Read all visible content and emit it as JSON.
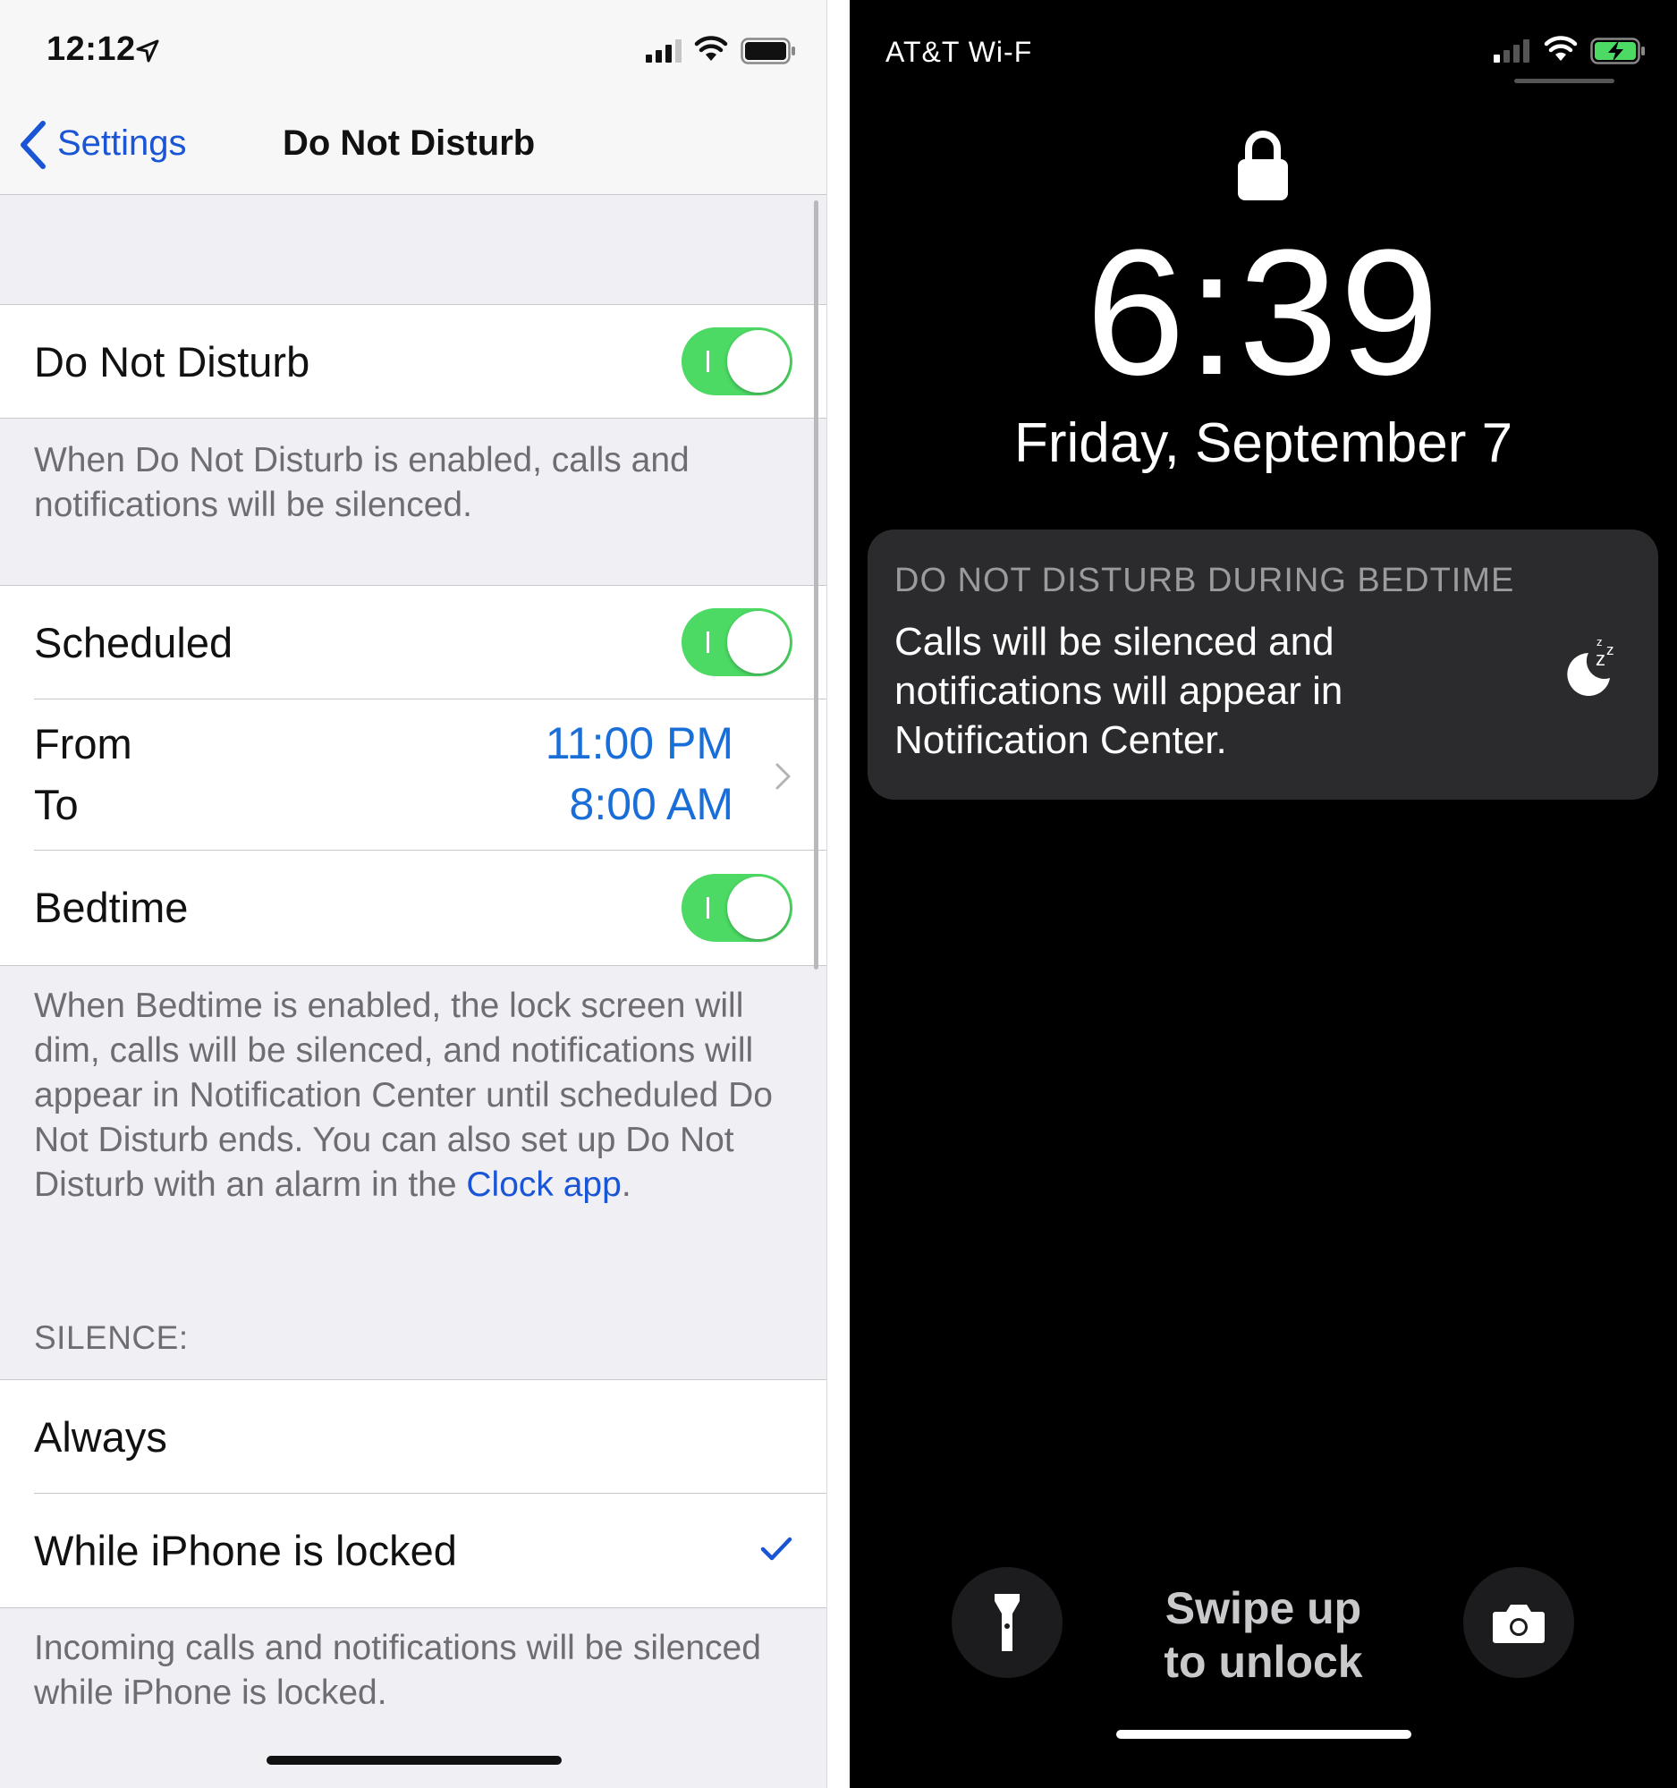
{
  "settings_screen": {
    "status_time": "12:12",
    "nav": {
      "back_label": "Settings",
      "title": "Do Not Disturb"
    },
    "dnd": {
      "label": "Do Not Disturb",
      "enabled": true,
      "footer": "When Do Not Disturb is enabled, calls and notifications will be silenced."
    },
    "scheduled": {
      "label": "Scheduled",
      "enabled": true
    },
    "schedule": {
      "from_label": "From",
      "from_value": "11:00 PM",
      "to_label": "To",
      "to_value": "8:00 AM"
    },
    "bedtime": {
      "label": "Bedtime",
      "enabled": true,
      "footer_prefix": "When Bedtime is enabled, the lock screen will dim, calls will be silenced, and notifications will appear in Notification Center until scheduled Do Not Disturb ends. You can also set up Do Not Disturb with an alarm in the ",
      "footer_link": "Clock app",
      "footer_suffix": "."
    },
    "silence": {
      "header": "SILENCE:",
      "options": [
        {
          "label": "Always",
          "selected": false
        },
        {
          "label": "While iPhone is locked",
          "selected": true
        }
      ],
      "footer": "Incoming calls and notifications will be silenced while iPhone is locked."
    },
    "colors": {
      "accent": "#1a55d6",
      "toggle_on": "#4cd964"
    }
  },
  "lock_screen": {
    "carrier": "AT&T Wi-F",
    "time": "6:39",
    "date": "Friday, September 7",
    "notification": {
      "title": "DO NOT DISTURB DURING BEDTIME",
      "body": "Calls will be silenced and notifications will appear in Notification Center.",
      "icon": "moon-sleep-icon"
    },
    "swipe_line1": "Swipe up",
    "swipe_line2": "to unlock",
    "icons": {
      "left": "flashlight-icon",
      "right": "camera-icon"
    }
  }
}
